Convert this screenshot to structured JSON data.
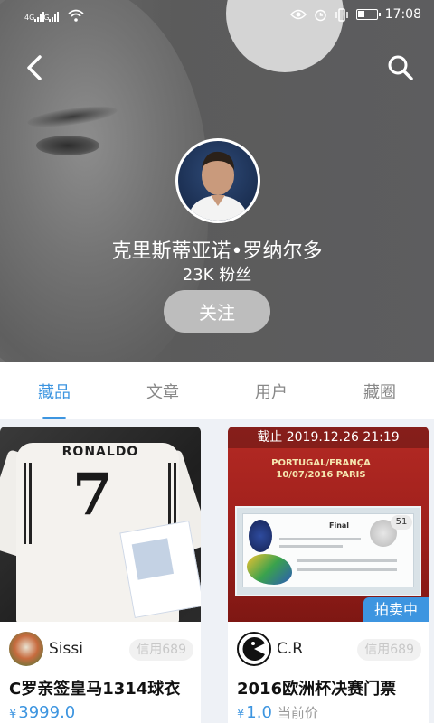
{
  "status_bar": {
    "signal_label_1": "4G",
    "signal_label_2": "4G",
    "time": "17:08"
  },
  "profile": {
    "name": "克里斯蒂亚诺•罗纳尔多",
    "followers": "23K 粉丝",
    "follow_label": "关注"
  },
  "tabs": [
    {
      "label": "藏品",
      "active": true
    },
    {
      "label": "文章",
      "active": false
    },
    {
      "label": "用户",
      "active": false
    },
    {
      "label": "藏圈",
      "active": false
    }
  ],
  "items": [
    {
      "image_jersey_name": "RONALDO",
      "image_jersey_number": "7",
      "seller": "Sissi",
      "credit": "信用689",
      "title": "C罗亲签皇马1314球衣",
      "currency": "¥",
      "price": "3999.0"
    },
    {
      "deadline": "截止 2019.12.26 21:19",
      "image_banner": "PORTUGAL/FRANÇA 10/07/2016 PARIS",
      "image_ticket_label": "Final",
      "image_ticket_number": "51",
      "badge": "拍卖中",
      "seller": "C.R",
      "credit": "信用689",
      "title": "2016欧洲杯决赛门票",
      "currency": "¥",
      "price": "1.0",
      "price_note": "当前价"
    }
  ],
  "colors": {
    "accent": "#3d95e0",
    "follow_button": "#bdbdbd"
  }
}
